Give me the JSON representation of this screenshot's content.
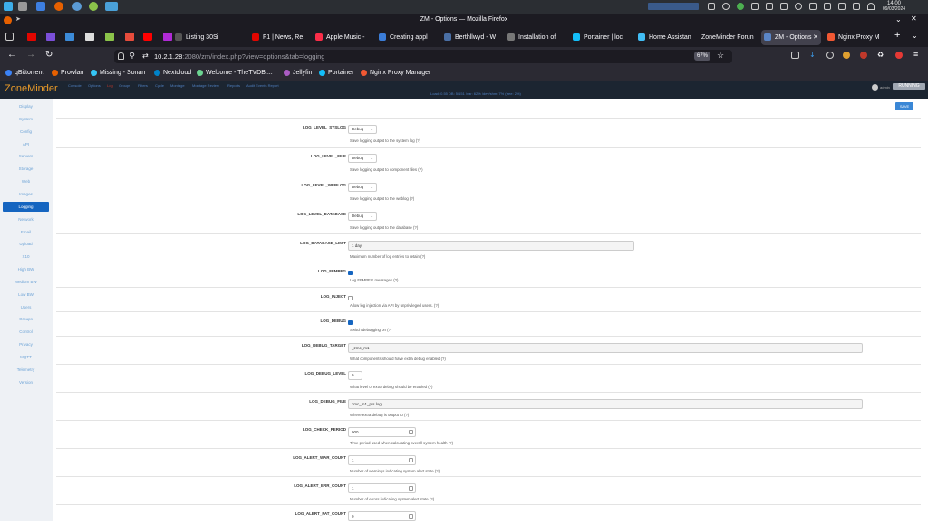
{
  "os": {
    "clock_time": "14:00",
    "clock_date": "09/03/2024"
  },
  "browser": {
    "window_title": "ZM - Options — Mozilla Firefox",
    "tabs": [
      {
        "label": "Listing 30Si",
        "color": "#888"
      },
      {
        "label": "F1 | News, Re",
        "color": "#e10600"
      },
      {
        "label": "Apple Music -",
        "color": "#fa2d48"
      },
      {
        "label": "Creating appl",
        "color": "#3b7dd8"
      },
      {
        "label": "Berthllwyd - W",
        "color": "#4a6fa5"
      },
      {
        "label": "Installation of",
        "color": "#777"
      },
      {
        "label": "Portainer | loc",
        "color": "#13bef9"
      },
      {
        "label": "Home Assistan",
        "color": "#41bdf5"
      },
      {
        "label": "ZoneMinder Forun",
        "color": "#555"
      },
      {
        "label": "ZM - Options",
        "color": "#1c2531"
      },
      {
        "label": "Nginx Proxy M",
        "color": "#f15833"
      }
    ],
    "url_host": "10.2.1.28",
    "url_rest": ":2080/zm/index.php?view=options&tab=logging",
    "zoom": "67%",
    "bookmarks": [
      {
        "label": "qBittorrent",
        "color": "#3b82f6"
      },
      {
        "label": "Prowlarr",
        "color": "#e66000"
      },
      {
        "label": "Missing - Sonarr",
        "color": "#35c5f4"
      },
      {
        "label": "Nextcloud",
        "color": "#0082c9"
      },
      {
        "label": "Welcome - TheTVDB....",
        "color": "#6cd491"
      },
      {
        "label": "Jellyfin",
        "color": "#aa5cc3"
      },
      {
        "label": "Portainer",
        "color": "#13bef9"
      },
      {
        "label": "Nginx Proxy Manager",
        "color": "#f15833"
      }
    ]
  },
  "zm": {
    "logo": "ZoneMinder",
    "nav": [
      "Console",
      "Options",
      "Log",
      "Groups",
      "Filters",
      "Cycle",
      "Montage",
      "Montage Review",
      "Reports",
      "Audit Events Report"
    ],
    "status": "Load: 0.55   DB: 5/151   /var: 62%   /dev/shm: 7% (free: 2%)",
    "user": "admin",
    "running": "RUNNING",
    "save_label": "SAVE",
    "sidebar": [
      "Display",
      "System",
      "Config",
      "API",
      "Servers",
      "Storage",
      "Web",
      "Images",
      "Logging",
      "Network",
      "Email",
      "Upload",
      "X10",
      "High BW",
      "Medium BW",
      "Low BW",
      "Users",
      "Groups",
      "Control",
      "Privacy",
      "MQTT",
      "Telemetry",
      "Version"
    ],
    "active_sidebar": "Logging",
    "options": [
      {
        "name": "LOG_LEVEL_SYSLOG",
        "type": "select",
        "value": "Debug",
        "help": "Save logging output to the system log (?)"
      },
      {
        "name": "LOG_LEVEL_FILE",
        "type": "select",
        "value": "Debug",
        "help": "Save logging output to component files (?)"
      },
      {
        "name": "LOG_LEVEL_WEBLOG",
        "type": "select",
        "value": "Debug",
        "help": "Save logging output to the weblog (?)"
      },
      {
        "name": "LOG_LEVEL_DATABASE",
        "type": "select",
        "value": "Debug",
        "help": "Save logging output to the database (?)"
      },
      {
        "name": "LOG_DATABASE_LIMIT",
        "type": "text",
        "value": "1 day",
        "help": "Maximum number of log entries to retain (?)"
      },
      {
        "name": "LOG_FFMPEG",
        "type": "checkbox",
        "checked": true,
        "help": "Log FFMPEG messages (?)"
      },
      {
        "name": "LOG_INJECT",
        "type": "checkbox",
        "checked": false,
        "help": "Allow log injection via API by unprivileged users. (?)"
      },
      {
        "name": "LOG_DEBUG",
        "type": "checkbox",
        "checked": true,
        "help": "Switch debugging on (?)"
      },
      {
        "name": "LOG_DEBUG_TARGET",
        "type": "textwide",
        "value": "_zmc_m1",
        "help": "What components should have extra debug enabled (?)"
      },
      {
        "name": "LOG_DEBUG_LEVEL",
        "type": "selectsmall",
        "value": "9",
        "help": "What level of extra debug should be enabled (?)"
      },
      {
        "name": "LOG_DEBUG_FILE",
        "type": "textwide",
        "value": "zmc_m1_pts.log",
        "help": "Where extra debug is output to (?)"
      },
      {
        "name": "LOG_CHECK_PERIOD",
        "type": "number",
        "value": "900",
        "help": "Time period used when calculating overall system health (?)"
      },
      {
        "name": "LOG_ALERT_WAR_COUNT",
        "type": "number",
        "value": "1",
        "help": "Number of warnings indicating system alert state (?)"
      },
      {
        "name": "LOG_ALERT_ERR_COUNT",
        "type": "number",
        "value": "1",
        "help": "Number of errors indicating system alert state (?)"
      },
      {
        "name": "LOG_ALERT_FAT_COUNT",
        "type": "number",
        "value": "0",
        "help": ""
      }
    ]
  }
}
